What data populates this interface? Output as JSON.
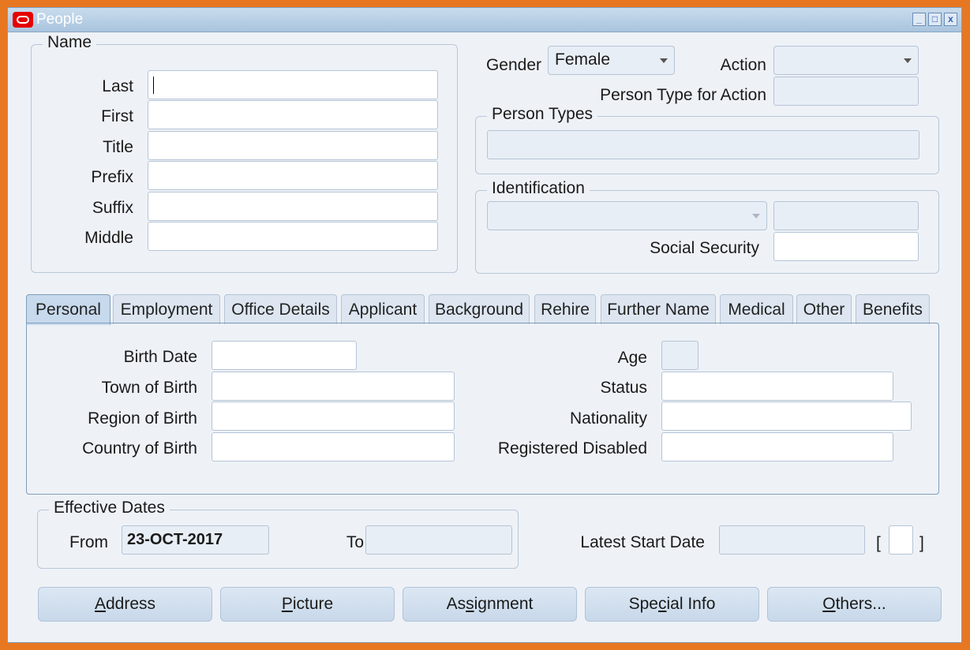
{
  "window": {
    "title": "People",
    "controls": {
      "minimize": "_",
      "maximize": "□",
      "close": "x"
    }
  },
  "name_group": {
    "legend": "Name",
    "last_label": "Last",
    "last_value": "",
    "first_label": "First",
    "first_value": "",
    "title_label": "Title",
    "title_value": "",
    "prefix_label": "Prefix",
    "prefix_value": "",
    "suffix_label": "Suffix",
    "suffix_value": "",
    "middle_label": "Middle",
    "middle_value": ""
  },
  "gender": {
    "label": "Gender",
    "value": "Female"
  },
  "action": {
    "label": "Action",
    "value": ""
  },
  "person_type_for_action": {
    "label": "Person Type for Action",
    "value": ""
  },
  "person_types": {
    "legend": "Person Types",
    "value": ""
  },
  "identification": {
    "legend": "Identification",
    "type_value": "",
    "number_value": "",
    "social_security_label": "Social Security",
    "social_security_value": ""
  },
  "tabs": [
    {
      "label": "Personal",
      "active": true
    },
    {
      "label": "Employment",
      "active": false
    },
    {
      "label": "Office Details",
      "active": false
    },
    {
      "label": "Applicant",
      "active": false
    },
    {
      "label": "Background",
      "active": false
    },
    {
      "label": "Rehire",
      "active": false
    },
    {
      "label": "Further Name",
      "active": false
    },
    {
      "label": "Medical",
      "active": false
    },
    {
      "label": "Other",
      "active": false
    },
    {
      "label": "Benefits",
      "active": false
    }
  ],
  "personal": {
    "birth_date_label": "Birth Date",
    "birth_date_value": "",
    "town_of_birth_label": "Town of Birth",
    "town_of_birth_value": "",
    "region_of_birth_label": "Region of Birth",
    "region_of_birth_value": "",
    "country_of_birth_label": "Country of Birth",
    "country_of_birth_value": "",
    "age_label": "Age",
    "age_value": "",
    "status_label": "Status",
    "status_value": "",
    "nationality_label": "Nationality",
    "nationality_value": "",
    "registered_disabled_label": "Registered Disabled",
    "registered_disabled_value": ""
  },
  "effective_dates": {
    "legend": "Effective Dates",
    "from_label": "From",
    "from_value": "23-OCT-2017",
    "to_label": "To",
    "to_value": ""
  },
  "latest_start_date": {
    "label": "Latest Start Date",
    "value": "",
    "bracket_open": "[",
    "bracket_close": "]",
    "flag_value": ""
  },
  "buttons": {
    "address": {
      "pre": "",
      "mnemonic": "A",
      "post": "ddress"
    },
    "picture": {
      "pre": "",
      "mnemonic": "P",
      "post": "icture"
    },
    "assignment": {
      "pre": "As",
      "mnemonic": "s",
      "post": "ignment"
    },
    "special_info": {
      "pre": "Spe",
      "mnemonic": "c",
      "post": "ial Info"
    },
    "others": {
      "pre": "",
      "mnemonic": "O",
      "post": "thers..."
    }
  }
}
